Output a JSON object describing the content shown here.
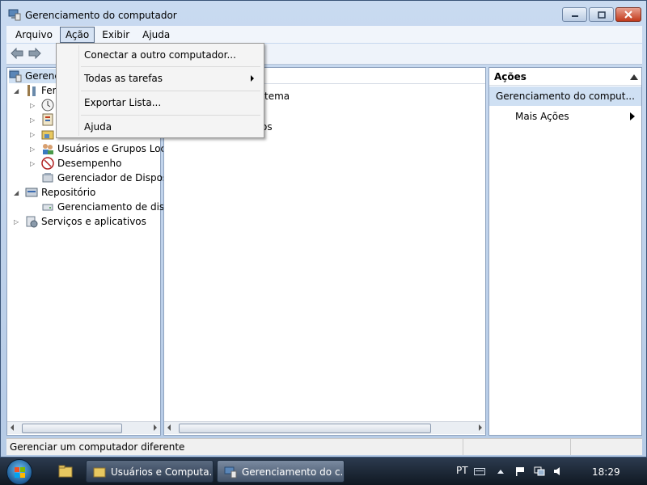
{
  "window": {
    "title": "Gerenciamento do computador"
  },
  "menubar": {
    "items": [
      "Arquivo",
      "Ação",
      "Exibir",
      "Ajuda"
    ]
  },
  "dropdown": {
    "items": [
      {
        "label": "Conectar a outro computador..."
      },
      {
        "label": "Todas as tarefas",
        "submenu": true
      },
      {
        "label": "Exportar Lista..."
      },
      {
        "label": "Ajuda"
      }
    ]
  },
  "tree": {
    "root": "Gerenc",
    "tools_partial": "Fer",
    "users_groups": "Usuários e Grupos Loca",
    "performance": "Desempenho",
    "device_manager": "Gerenciador de Disposit",
    "storage": "Repositório",
    "disk_management": "Gerenciamento de disco",
    "services": "Serviços e aplicativos"
  },
  "center": {
    "line1": "tema",
    "line2": "os"
  },
  "actions": {
    "header": "Ações",
    "selected": "Gerenciamento do comput...",
    "more": "Mais Ações"
  },
  "statusbar": {
    "text": "Gerenciar um computador diferente"
  },
  "taskbar": {
    "buttons": [
      "Usuários e Computa...",
      "Gerenciamento do c..."
    ],
    "language": "PT",
    "time": "18:29"
  },
  "colors": {
    "selection": "#cfe0f3",
    "taskbar": "#1a2636",
    "close_button": "#c23a1c"
  }
}
